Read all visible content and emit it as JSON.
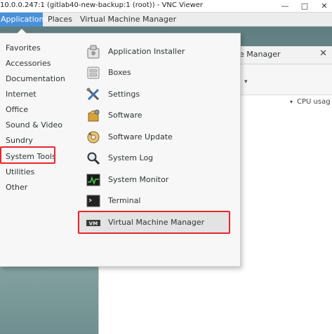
{
  "vnc": {
    "title": "10.0.0.247:1 (gitlab40-new-backup:1 (root)) - VNC Viewer",
    "minimize_glyph": "—",
    "maximize_glyph": "□",
    "close_glyph": "✕"
  },
  "topbar": {
    "applications": "Applications",
    "places": "Places",
    "vmm": "Virtual Machine Manager"
  },
  "background_window": {
    "title_fragment": "e Manager",
    "close_glyph": "✕",
    "dropdown_glyph": "▾",
    "column_header": "CPU usag"
  },
  "menu": {
    "categories": [
      "Favorites",
      "Accessories",
      "Documentation",
      "Internet",
      "Office",
      "Sound & Video",
      "Sundry",
      "System Tools",
      "Utilities",
      "Other"
    ],
    "selected_category": "System Tools",
    "apps": [
      {
        "label": "Application Installer",
        "icon": "package-installer-icon"
      },
      {
        "label": "Boxes",
        "icon": "boxes-icon"
      },
      {
        "label": "Settings",
        "icon": "settings-tools-icon"
      },
      {
        "label": "Software",
        "icon": "software-package-icon"
      },
      {
        "label": "Software Update",
        "icon": "software-update-icon"
      },
      {
        "label": "System Log",
        "icon": "magnifier-log-icon"
      },
      {
        "label": "System Monitor",
        "icon": "system-monitor-icon"
      },
      {
        "label": "Terminal",
        "icon": "terminal-icon"
      },
      {
        "label": "Virtual Machine Manager",
        "icon": "virt-manager-icon"
      }
    ],
    "highlight_color": "#e8262e",
    "accent_color": "#4a90d9"
  }
}
